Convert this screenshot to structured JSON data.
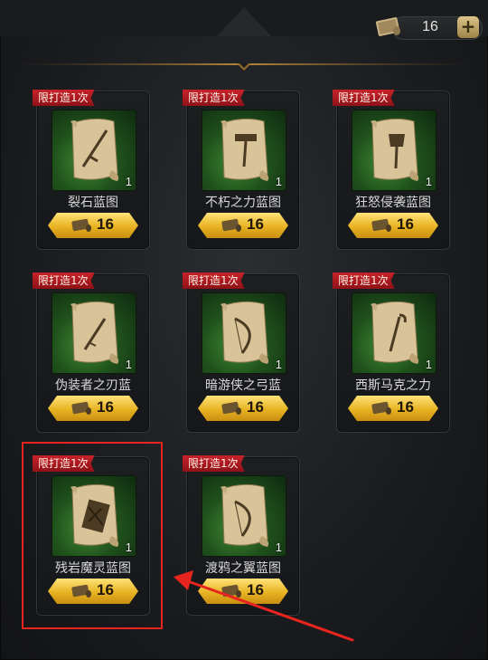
{
  "header": {
    "currency_icon": "blueprint-scroll-icon",
    "currency_count": "16",
    "add_button": "+"
  },
  "blueprints": [
    {
      "tag": "限打造1次",
      "name": "裂石蓝图",
      "quantity": "1",
      "cost": "16",
      "icon": "sword-icon"
    },
    {
      "tag": "限打造1次",
      "name": "不朽之力蓝图",
      "quantity": "1",
      "cost": "16",
      "icon": "hammer-icon"
    },
    {
      "tag": "限打造1次",
      "name": "狂怒侵袭蓝图",
      "quantity": "1",
      "cost": "16",
      "icon": "axe-icon"
    },
    {
      "tag": "限打造1次",
      "name": "伪装者之刃蓝",
      "quantity": "1",
      "cost": "16",
      "icon": "dagger-icon"
    },
    {
      "tag": "限打造1次",
      "name": "暗游侠之弓蓝",
      "quantity": "1",
      "cost": "16",
      "icon": "bow-icon"
    },
    {
      "tag": "限打造1次",
      "name": "西斯马克之力",
      "quantity": "1",
      "cost": "16",
      "icon": "staff-icon"
    },
    {
      "tag": "限打造1次",
      "name": "残岩魔灵蓝图",
      "quantity": "1",
      "cost": "16",
      "icon": "book-icon"
    },
    {
      "tag": "限打造1次",
      "name": "渡鸦之翼蓝图",
      "quantity": "1",
      "cost": "16",
      "icon": "bow-icon"
    }
  ],
  "colors": {
    "tag_red": "#c7222a",
    "cost_gold": "#e7b322",
    "highlight_red": "#e8241e",
    "thumb_green": "#3f8a33"
  }
}
